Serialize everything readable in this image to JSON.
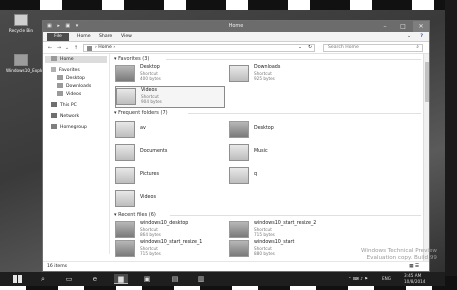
{
  "desktop": {
    "icons": [
      {
        "label": "Recycle Bin",
        "icon": "recycle-bin-icon"
      },
      {
        "label": "Windows10_Explorer",
        "icon": "explorer-shortcut-icon"
      }
    ],
    "watermark_lines": [
      "Windows Technical Preview",
      "Evaluation copy. Build 99"
    ]
  },
  "window": {
    "title": "Home",
    "quick_access_icons": "▣ ▸ ▣ ▾",
    "controls": {
      "minimize": "–",
      "maximize": "□",
      "close": "✕"
    },
    "ribbon_tabs": [
      "File",
      "Home",
      "Share",
      "View"
    ],
    "ribbon_expand": "⌄",
    "help": "?",
    "address": {
      "back": "←",
      "forward": "→",
      "up": "↑",
      "recent": "⌄",
      "path": "› Home ›",
      "dropdown": "⌄",
      "refresh": "↻",
      "search_placeholder": "Search Home",
      "search_icon": "⌕"
    },
    "nav": {
      "home": "Home",
      "favorites": "Favorites",
      "favorites_items": [
        "Desktop",
        "Downloads",
        "Videos"
      ],
      "this_pc": "This PC",
      "network": "Network",
      "homegroup": "Homegroup"
    },
    "favorites_header": "Favorites (3)",
    "favorites": [
      {
        "name": "Desktop",
        "type": "Shortcut",
        "size": "400 bytes"
      },
      {
        "name": "Downloads",
        "type": "Shortcut",
        "size": "925 bytes"
      },
      {
        "name": "Videos",
        "type": "Shortcut",
        "size": "904 bytes"
      }
    ],
    "frequent_header": "Frequent folders (7)",
    "frequent": [
      "av",
      "Desktop",
      "Documents",
      "Music",
      "Pictures",
      "q",
      "Videos"
    ],
    "recent_header": "Recent files (6)",
    "recent": [
      {
        "name": "windows10_desktop",
        "type": "Shortcut",
        "size": "864 bytes"
      },
      {
        "name": "windows10_start_resize_2",
        "type": "Shortcut",
        "size": "715 bytes"
      },
      {
        "name": "windows10_start_resize_1",
        "type": "Shortcut",
        "size": "715 bytes"
      },
      {
        "name": "windows10_start",
        "type": "Shortcut",
        "size": "880 bytes"
      }
    ],
    "status": "16 items",
    "view_toggle": "▦ ☰"
  },
  "taskbar": {
    "clock_time": "3:45 AM",
    "clock_date": "10/8/2014",
    "language": "ENG",
    "tray_icons": "⌃ ⌨ ♪ ⚑"
  },
  "colors": {
    "titlebar": "#6c6c6c",
    "file_tab": "#4d4d4d",
    "taskbar": "#1e1e1e"
  }
}
